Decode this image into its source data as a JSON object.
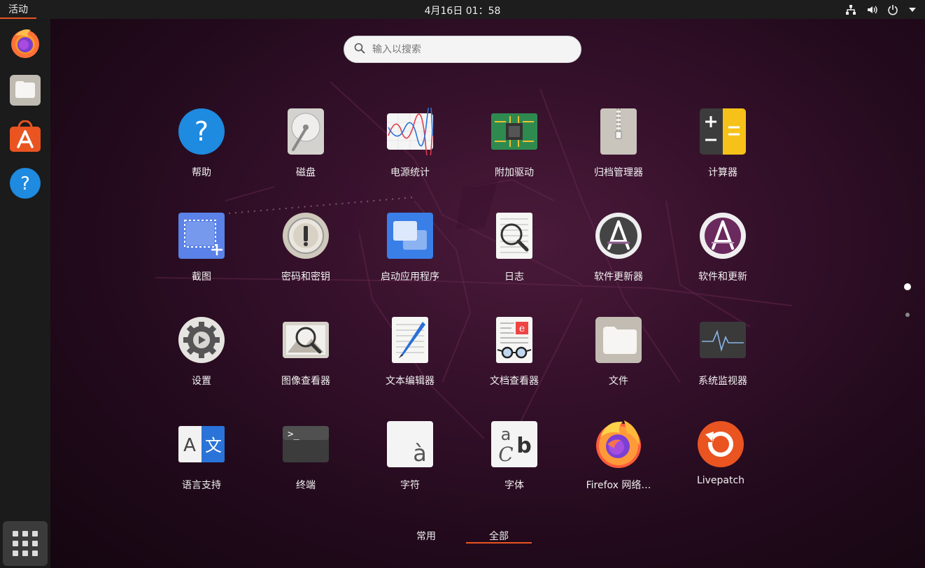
{
  "topbar": {
    "activities": "活动",
    "clock": "4月16日  01：58",
    "tray_icons": [
      "network-icon",
      "volume-icon",
      "power-icon",
      "chevron-down-icon"
    ]
  },
  "search": {
    "placeholder": "输入以搜索"
  },
  "dock": {
    "items": [
      "firefox-icon",
      "files-icon",
      "software-icon",
      "help-icon"
    ],
    "show_apps": "grid-icon"
  },
  "apps": [
    {
      "label": "帮助",
      "icon": "help-icon"
    },
    {
      "label": "磁盘",
      "icon": "disk-icon"
    },
    {
      "label": "电源统计",
      "icon": "power-stats-icon"
    },
    {
      "label": "附加驱动",
      "icon": "chip-icon"
    },
    {
      "label": "归档管理器",
      "icon": "archive-icon"
    },
    {
      "label": "计算器",
      "icon": "calculator-icon"
    },
    {
      "label": "截图",
      "icon": "screenshot-icon"
    },
    {
      "label": "密码和密钥",
      "icon": "keyring-icon"
    },
    {
      "label": "启动应用程序",
      "icon": "startup-apps-icon"
    },
    {
      "label": "日志",
      "icon": "logs-icon"
    },
    {
      "label": "软件更新器",
      "icon": "software-updater-icon"
    },
    {
      "label": "软件和更新",
      "icon": "software-properties-icon"
    },
    {
      "label": "设置",
      "icon": "settings-gear-icon"
    },
    {
      "label": "图像查看器",
      "icon": "image-viewer-icon"
    },
    {
      "label": "文本编辑器",
      "icon": "text-editor-icon"
    },
    {
      "label": "文档查看器",
      "icon": "document-viewer-icon"
    },
    {
      "label": "文件",
      "icon": "files-icon"
    },
    {
      "label": "系统监视器",
      "icon": "system-monitor-icon"
    },
    {
      "label": "语言支持",
      "icon": "language-icon"
    },
    {
      "label": "终端",
      "icon": "terminal-icon"
    },
    {
      "label": "字符",
      "icon": "characters-icon"
    },
    {
      "label": "字体",
      "icon": "fonts-icon"
    },
    {
      "label": "Firefox 网络…",
      "icon": "firefox-icon"
    },
    {
      "label": "Livepatch",
      "icon": "livepatch-icon"
    }
  ],
  "tabs": {
    "frequent": "常用",
    "all": "全部",
    "active": "all"
  },
  "colors": {
    "accent": "#e95420",
    "topbar": "#1d1d1d",
    "dock": "#1b1b1b"
  }
}
